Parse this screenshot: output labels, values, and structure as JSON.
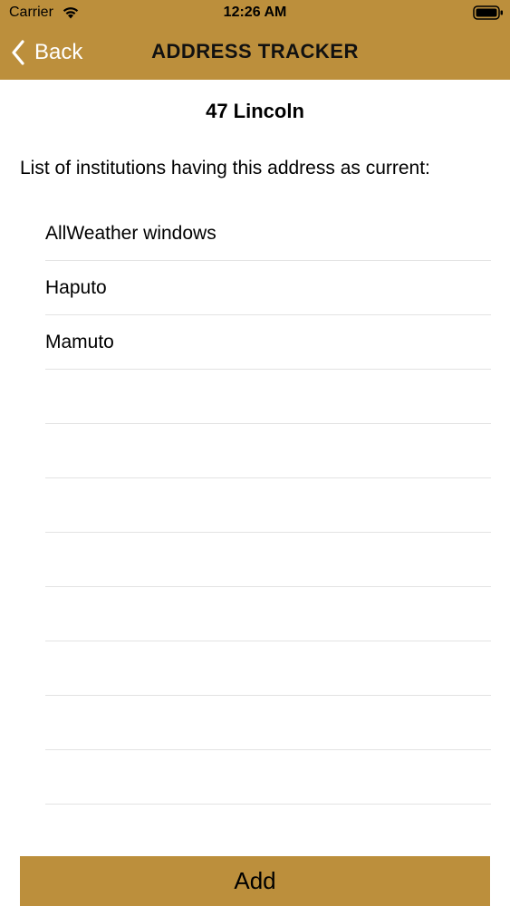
{
  "status_bar": {
    "carrier": "Carrier",
    "time": "12:26 AM",
    "wifi_icon": "wifi-icon",
    "battery_icon": "battery-icon"
  },
  "nav": {
    "back_label": "Back",
    "back_icon": "chevron-left-icon",
    "title": "ADDRESS TRACKER"
  },
  "address": {
    "title": "47 Lincoln"
  },
  "institutions": {
    "caption": "List of institutions having this address as current:",
    "items": [
      "AllWeather windows",
      "Haputo",
      "Mamuto",
      "",
      "",
      "",
      "",
      "",
      "",
      "",
      "",
      ""
    ]
  },
  "actions": {
    "add_label": "Add"
  },
  "colors": {
    "accent": "#BC8F3C",
    "separator": "#E3E3E3"
  }
}
